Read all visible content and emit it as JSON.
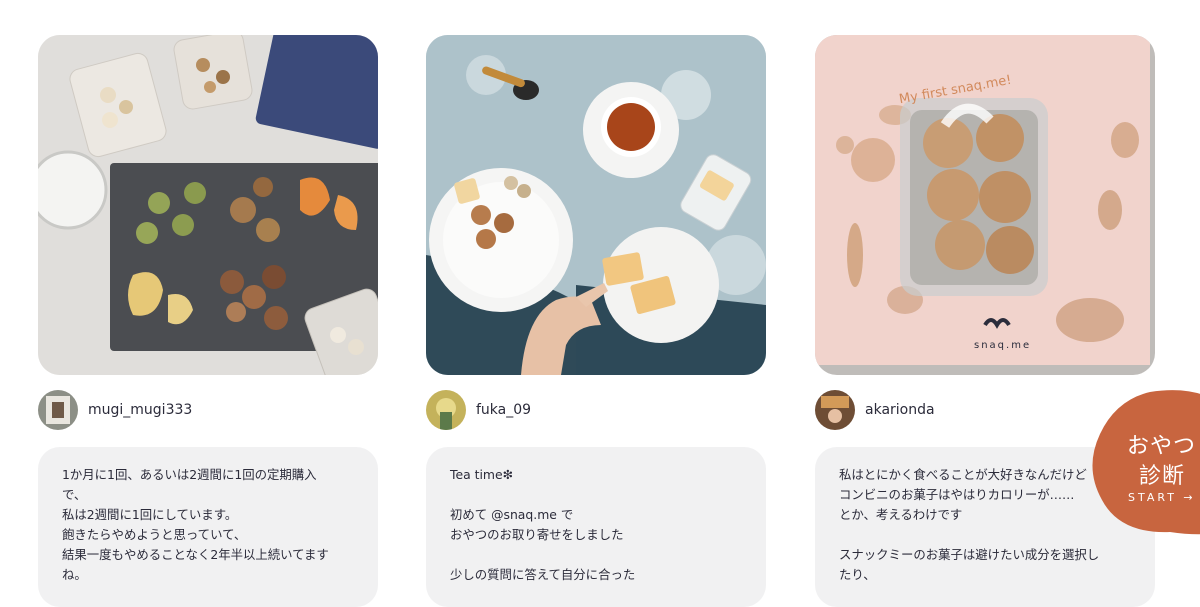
{
  "posts": [
    {
      "username": "mugi_mugi333",
      "image_subject": "snacks-on-slate-board-photo",
      "text": "1か月に1回、あるいは2週間に1回の定期購入\nで、\n私は2週間に1回にしています。\n飽きたらやめようと思っていて、\n結果一度もやめることなく2年半以上続いてます\nね。"
    },
    {
      "username": "fuka_09",
      "image_subject": "tea-and-cookies-on-plates-photo",
      "text": "Tea time❇︎\n\n初めて @snaq.me で\nおやつのお取り寄せをしました\n\n少しの質問に答えて自分に合った"
    },
    {
      "username": "akarionda",
      "image_subject": "snaq-me-cookie-package-photo",
      "package_text": "My first snaq.me!",
      "brand_text": "snaq.me",
      "text": "私はとにかく食べることが大好きなんだけど\nコンビニのお菓子はやはりカロリーが……\nとか、考えるわけです\n\nスナックミーのお菓子は避けたい成分を選択し\nたり、"
    }
  ],
  "diagnosis_badge": {
    "line1": "おやつ",
    "line2": "診断",
    "line3": "START →",
    "color": "#c8653f"
  },
  "colors": {
    "card_background": "#f1f1f2",
    "text": "#2b2b3a"
  }
}
